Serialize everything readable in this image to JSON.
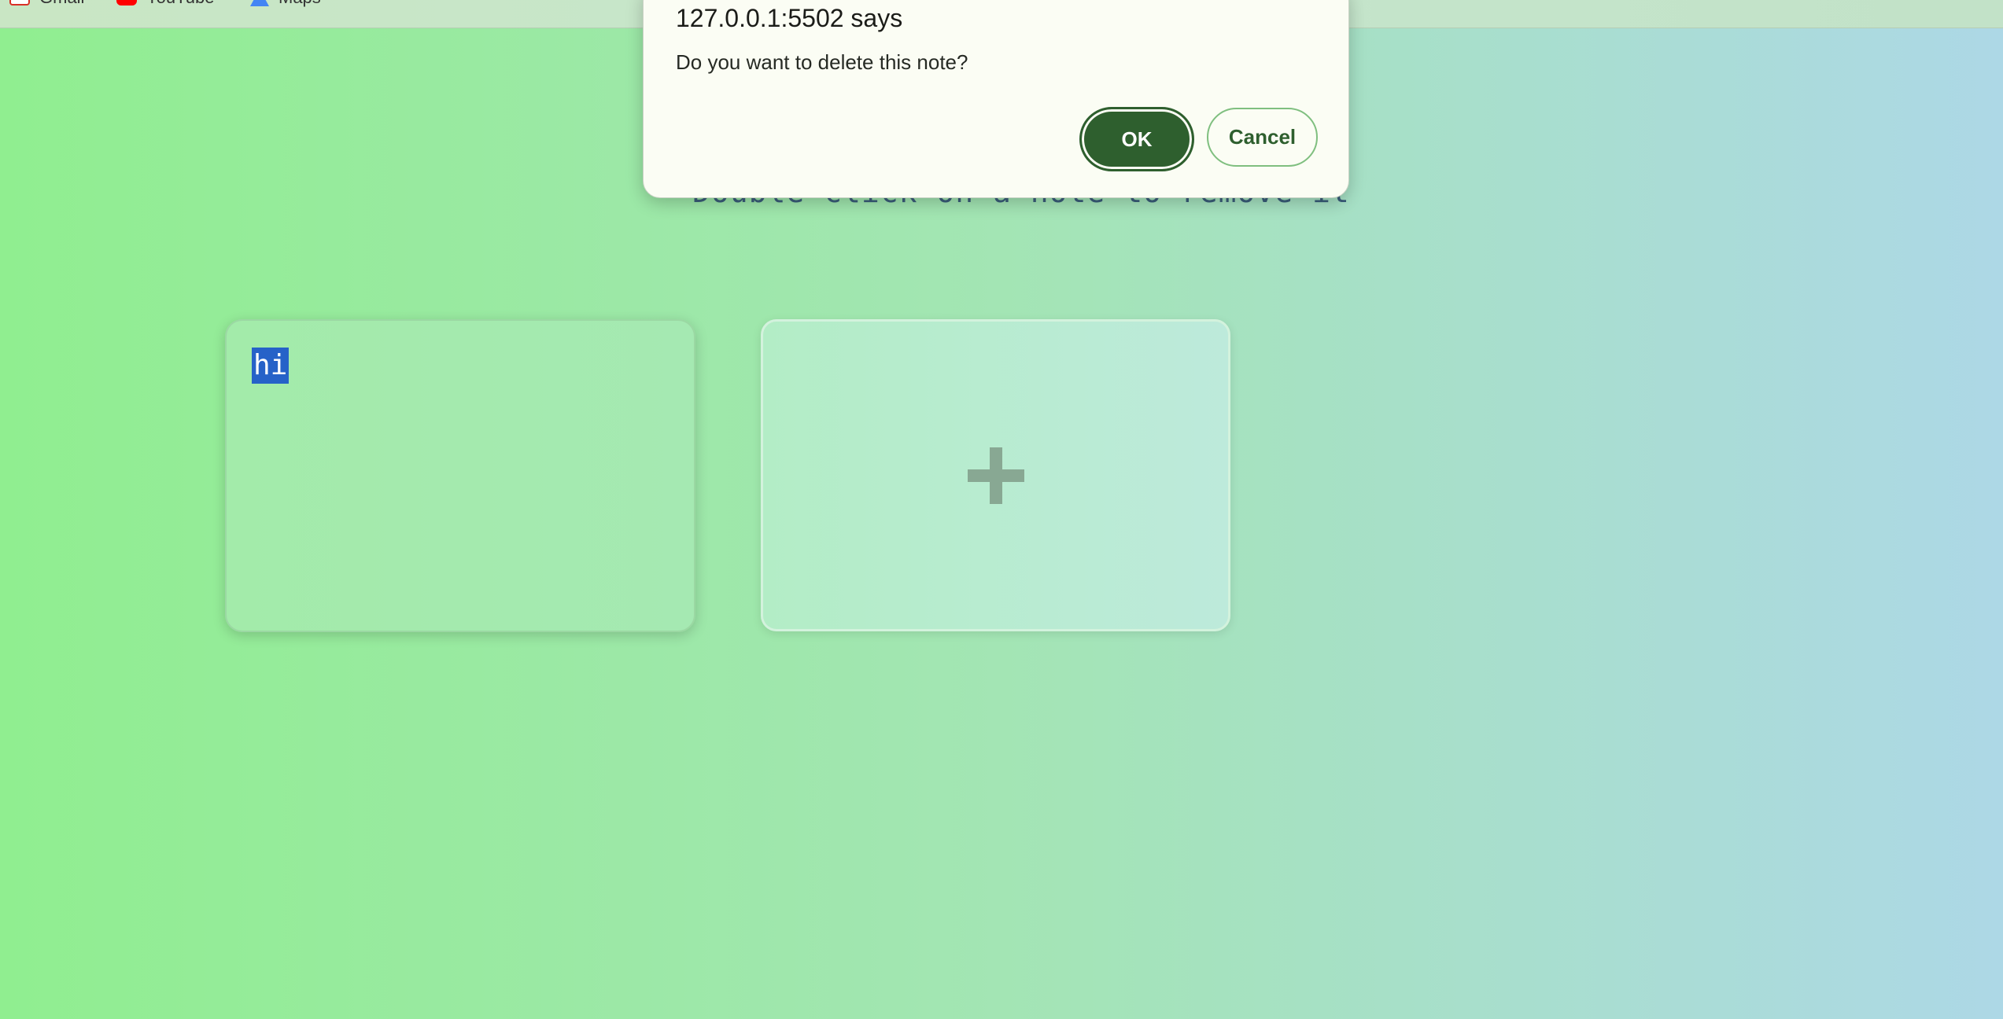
{
  "bookmarks": [
    {
      "label": "Gmail",
      "icon": "gmail-icon"
    },
    {
      "label": "YouTube",
      "icon": "youtube-icon"
    },
    {
      "label": "Maps",
      "icon": "maps-icon"
    }
  ],
  "page": {
    "subtitle": "Double click on a note to remove it"
  },
  "notes": [
    {
      "text": "hi"
    }
  ],
  "add_note": {
    "icon": "plus-icon"
  },
  "dialog": {
    "title": "127.0.0.1:5502 says",
    "message": "Do you want to delete this note?",
    "ok_label": "OK",
    "cancel_label": "Cancel"
  },
  "colors": {
    "background_start": "#90ee90",
    "background_end": "#add8e6",
    "ok_button": "#2e5f2e",
    "text_selection": "#2662c8"
  }
}
